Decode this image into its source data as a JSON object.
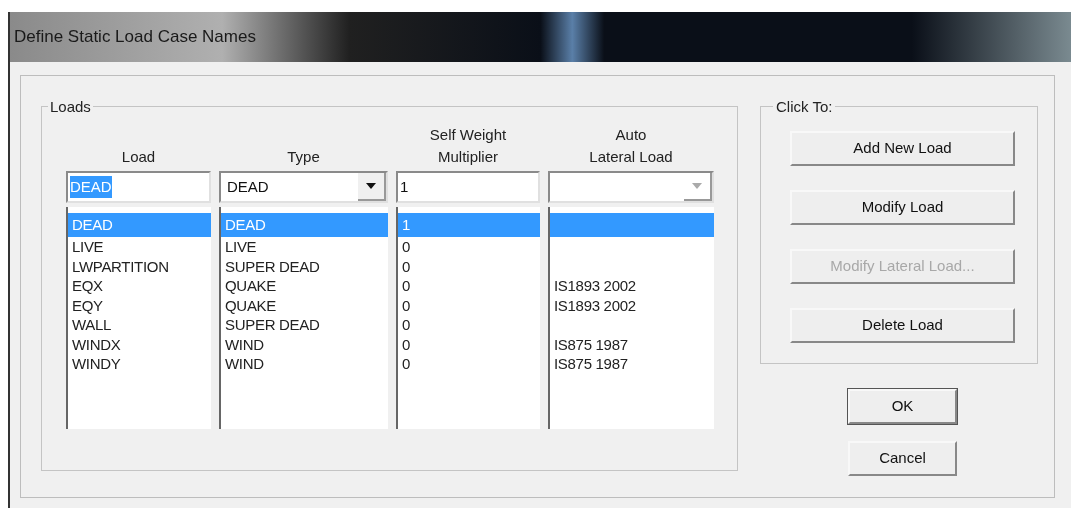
{
  "window": {
    "title": "Define Static Load Case Names"
  },
  "loads": {
    "title": "Loads",
    "columns": [
      {
        "header": [
          "Load"
        ]
      },
      {
        "header": [
          "Type"
        ]
      },
      {
        "header": [
          "Self Weight",
          "Multiplier"
        ]
      },
      {
        "header": [
          "Auto",
          "Lateral Load"
        ]
      }
    ],
    "editors": [
      {
        "kind": "text",
        "value": "DEAD",
        "selected": true
      },
      {
        "kind": "dropdown",
        "value": "DEAD",
        "disabled": false
      },
      {
        "kind": "text",
        "value": "1",
        "selected": false
      },
      {
        "kind": "dropdown",
        "disabled": true
      }
    ],
    "rows": [
      {
        "load": "DEAD",
        "type": "DEAD",
        "multiplier": "1",
        "lateral": "",
        "selected": true
      },
      {
        "load": "LIVE",
        "type": "LIVE",
        "multiplier": "0",
        "lateral": "",
        "selected": false
      },
      {
        "load": "LWPARTITION",
        "type": "SUPER DEAD",
        "multiplier": "0",
        "lateral": "",
        "selected": false
      },
      {
        "load": "EQX",
        "type": "QUAKE",
        "multiplier": "0",
        "lateral": "IS1893 2002",
        "selected": false
      },
      {
        "load": "EQY",
        "type": "QUAKE",
        "multiplier": "0",
        "lateral": "IS1893 2002",
        "selected": false
      },
      {
        "load": "WALL",
        "type": "SUPER DEAD",
        "multiplier": "0",
        "lateral": "",
        "selected": false
      },
      {
        "load": "WINDX",
        "type": "WIND",
        "multiplier": "0",
        "lateral": "IS875 1987",
        "selected": false
      },
      {
        "load": "WINDY",
        "type": "WIND",
        "multiplier": "0",
        "lateral": "IS875 1987",
        "selected": false
      }
    ]
  },
  "click_to": {
    "title": "Click To:",
    "buttons": [
      {
        "label": "Add New Load",
        "disabled": false
      },
      {
        "label": "Modify Load",
        "disabled": false
      },
      {
        "label": "Modify Lateral Load...",
        "disabled": true
      },
      {
        "label": "Delete Load",
        "disabled": false
      }
    ]
  },
  "buttons": [
    {
      "label": "OK",
      "default": true
    },
    {
      "label": "Cancel",
      "default": false
    }
  ]
}
